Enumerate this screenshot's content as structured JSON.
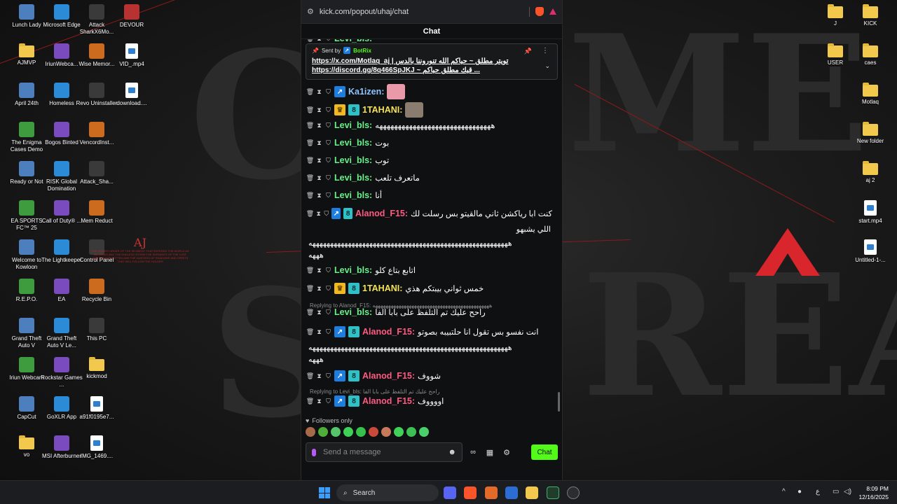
{
  "browser": {
    "url": "kick.com/popout/uhaj/chat",
    "panel_title": "Chat"
  },
  "pinned": {
    "sent_by_label": "Sent by",
    "bot_name": "BotRix",
    "line1": "https://x.com/Motlaq_aj | تويتر مطلق ~ حياكم الله تنوروننا بالدس",
    "line2": "https://discord.gg/8q466SpJKJ ~ قيك مطلق حياكم ..."
  },
  "messages": [
    {
      "user": "Levi_bls:",
      "text": "",
      "color": "#68f28a",
      "badges": [],
      "emote": false,
      "partial": true
    },
    {
      "user": "Ka1izen:",
      "text": "",
      "color": "#8fc4ff",
      "badges": [
        "blue"
      ],
      "emote": true
    },
    {
      "user": "1TAHANI:",
      "text": "",
      "color": "#f3e35a",
      "badges": [
        "gold",
        "teal"
      ],
      "emote": true
    },
    {
      "user": "Levi_bls:",
      "text": "هههههههههههههههههههههههههههههههه",
      "color": "#68f28a",
      "badges": []
    },
    {
      "user": "Levi_bls:",
      "text": "بوت",
      "color": "#68f28a",
      "badges": []
    },
    {
      "user": "Levi_bls:",
      "text": "توب",
      "color": "#68f28a",
      "badges": []
    },
    {
      "user": "Levi_bls:",
      "text": "ماتعرف تلعب",
      "color": "#68f28a",
      "badges": []
    },
    {
      "user": "Levi_bls:",
      "text": "أنا",
      "color": "#68f28a",
      "badges": []
    },
    {
      "user": "Alanod_F15:",
      "text": "كنت ابا رياكشن ثاني مالقيتو بس رسلت لك",
      "color": "#ff5a82",
      "badges": [
        "blue",
        "teal"
      ]
    },
    {
      "user": "Levi_bls:",
      "text": "اتابع بتاع كلو",
      "color": "#68f28a",
      "badges": []
    },
    {
      "user": "1TAHANI:",
      "text": "خمس ثواني بيبتكم هذي",
      "color": "#f3e35a",
      "badges": [
        "gold",
        "teal"
      ]
    },
    {
      "user": "Levi_bls:",
      "text": "راحح عليك تم التلفظ على بابا الفا",
      "color": "#68f28a",
      "badges": []
    },
    {
      "user": "Alanod_F15:",
      "text": "انت نفسو بس تقول انا حلتبيبه بصوتو",
      "color": "#ff5a82",
      "badges": [
        "blue",
        "teal"
      ]
    },
    {
      "user": "Alanod_F15:",
      "text": "شووف",
      "color": "#ff5a82",
      "badges": [
        "blue",
        "teal"
      ]
    },
    {
      "user": "Alanod_F15:",
      "text": "اووووف",
      "color": "#ff5a82",
      "badges": [
        "blue",
        "teal"
      ]
    }
  ],
  "wraps": {
    "alanod1_l2": "اللي يشبهو",
    "alanod1_l3": "ههههههههههههههههههههههههههههههههههههههههههههههههههههههههه",
    "alanod1_l4": "هههه",
    "alanod2_l2": "ههههههههههههههههههههههههههههههههههههههههههههههههههههههههه",
    "alanod2_l3": "هههه"
  },
  "replies": {
    "r1": "Replying to Alanod_F15: هههههههههههههههههههههههههههههههههههههههههههههه",
    "r2": "Replying to Levi_bls: راحح عليك تم التلفظ على بابا الفا"
  },
  "footer": {
    "followers_only": "Followers only",
    "placeholder": "Send a message",
    "send_label": "Chat"
  },
  "desktop_left": [
    [
      "Lunch Lady",
      "Microsoft Edge",
      "Attack SharkX6Mo...",
      "DEVOUR"
    ],
    [
      "AJMVP",
      "IriunWebca...",
      "Wise Memor...",
      "VID_.mp4"
    ],
    [
      "April 24th",
      "Homeless",
      "Revo Uninstaller",
      "download...."
    ],
    [
      "The Enigma Cases Demo",
      "Bogos Binted",
      "VencordInst...",
      ""
    ],
    [
      "Ready or Not",
      "RISK Global Domination",
      "Attack_Sha...",
      ""
    ],
    [
      "EA SPORTS FC™ 25",
      "Call of Duty® ...",
      "Mem Reduct",
      ""
    ],
    [
      "Welcome to Kowloon",
      "The Lightkeeper",
      "Control Panel",
      ""
    ],
    [
      "R.E.P.O.",
      "EA",
      "Recycle Bin",
      ""
    ],
    [
      "Grand Theft Auto V",
      "Grand Theft Auto V Le...",
      "This PC",
      ""
    ],
    [
      "Iriun Webcam",
      "Rockstar Games ...",
      "kickmod",
      ""
    ],
    [
      "CapCut",
      "GoXLR App",
      "a91f0195e7...",
      ""
    ],
    [
      "vo",
      "MSI Afterburner",
      "IMG_1469....",
      ""
    ]
  ],
  "desktop_right": [
    [
      "J",
      "KICK"
    ],
    [
      "USER",
      "caes"
    ],
    [
      "",
      "Motlaq"
    ],
    [
      "",
      "New folder"
    ],
    [
      "",
      "aj 2"
    ],
    [
      "",
      "start.mp4"
    ],
    [
      "",
      "Untitled-1-..."
    ]
  ],
  "aj_note": {
    "title": "AJ",
    "body": "THE HIGHER ORDER OF THE SEGMENT THAT ENTERED THE WORLD AS AN ASHES AND THE ENDLESS STORM THE SERVANTS OF THE LOST AND THE FORGOTTEN AND THE HUNTERS OF SHADOWS AND SPIRITS THAT WILL FOLLOW THE HOLDER"
  },
  "taskbar": {
    "search_label": "Search",
    "lang": "ع",
    "time": "8:09 PM",
    "date": "12/16/2025"
  }
}
